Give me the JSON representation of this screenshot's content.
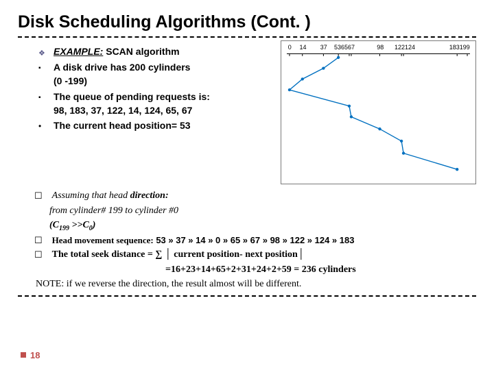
{
  "title": "Disk Scheduling Algorithms (Cont. )",
  "example_label": "EXAMPLE:",
  "algo_name": "SCAN algorithm",
  "b1a": "A disk drive has 200 cylinders",
  "b1b": "(0 -199)",
  "b2a": "The queue of pending requests is:",
  "b2b": "98, 183, 37, 122, 14, 124, 65, 67",
  "b3": "The current head position=  53",
  "assume_a": "Assuming that head",
  "assume_b": "direction:",
  "assume_line2": "from cylinder# 199 to cylinder #0",
  "cline_a": "(C",
  "cline_b": "199",
  "cline_c": ">>C",
  "cline_d": "0",
  "cline_e": ")",
  "head_seq_label": "Head movement sequence:",
  "head_seq_value": "53 » 37 » 14 » 0  » 65 » 67 » 98 » 122 » 124  »  183",
  "total_label": "The total seek distance = ∑ │ current position- next position│",
  "calc": "=16+23+14+65+2+31+24+2+59 = 236 cylinders",
  "note_label": "NOTE:",
  "note_text": "if we reverse the direction, the result almost will be different.",
  "page": "18",
  "chart_data": {
    "type": "line",
    "x_range": [
      0,
      199
    ],
    "x_ticks": [
      0,
      14,
      37,
      53,
      65,
      67,
      98,
      122,
      124,
      183,
      199
    ],
    "x_tick_labels": [
      "0",
      "14",
      "37",
      "536567",
      "98",
      "122124",
      "183199"
    ],
    "title": "",
    "xlabel": "",
    "ylabel": "",
    "sequence": [
      {
        "x": 53,
        "step": 0
      },
      {
        "x": 37,
        "step": 1
      },
      {
        "x": 14,
        "step": 2
      },
      {
        "x": 0,
        "step": 3
      },
      {
        "x": 65,
        "step": 4
      },
      {
        "x": 67,
        "step": 5
      },
      {
        "x": 98,
        "step": 6
      },
      {
        "x": 122,
        "step": 7
      },
      {
        "x": 124,
        "step": 8
      },
      {
        "x": 183,
        "step": 9
      }
    ]
  }
}
